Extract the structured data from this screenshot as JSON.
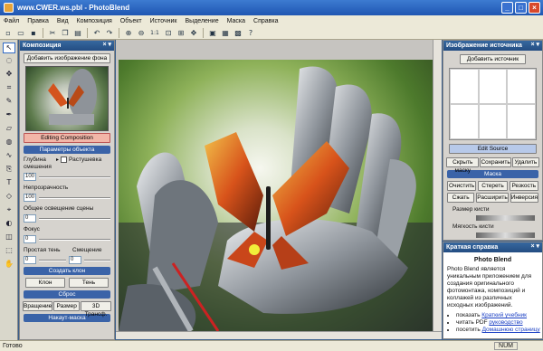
{
  "window": {
    "title": "www.CWER.ws.pbl - PhotoBlend"
  },
  "menu": [
    "Файл",
    "Правка",
    "Вид",
    "Композиция",
    "Объект",
    "Источник",
    "Выделение",
    "Маска",
    "Справка"
  ],
  "toolbar": {
    "zoom_label": "1:1"
  },
  "composition_panel": {
    "title": "Композиция",
    "add_bg_button": "Добавить изображение фона",
    "editing_button": "Editing Composition",
    "object_params_header": "Параметры объекта",
    "blend_depth_label": "Глубина смешения",
    "feather_label": "Растушевка",
    "blend_depth_value": "100",
    "opacity_label": "Непрозрачность",
    "opacity_value": "100",
    "lighting_label": "Общее освещение сцены",
    "lighting_value": "0",
    "focus_label": "Фокус",
    "focus_value": "0",
    "shadow_label": "Простая тень",
    "offset_label": "Смещение",
    "shadow_value": "0",
    "offset_value": "0",
    "create_clone_header": "Создать клон",
    "clone_button": "Клон",
    "shadow_button": "Тень",
    "reset_header": "Сброс",
    "rotation_button": "Вращение",
    "size_button": "Размер",
    "transform_button": "3D Трансф.",
    "overlay_mask_header": "Накаут-маска"
  },
  "source_panel": {
    "title": "Изображение источника",
    "add_source_button": "Добавить источник",
    "edit_source_button": "Edit Source",
    "hide_mask_button": "Скрыть маску",
    "save_button": "Сохранить",
    "delete_button": "Удалить",
    "mask_header": "Маска",
    "clear_button": "Очистить",
    "erase_button": "Стереть",
    "sharpness_button": "Резкость",
    "compress_button": "Сжать",
    "expand_button": "Расширить",
    "invert_button": "Инверсия",
    "brush_size_label": "Размер кисти",
    "brush_softness_label": "Мягкость кисти"
  },
  "help_panel": {
    "title": "Краткая справка",
    "heading": "Photo Blend",
    "body": "Photo Blend является уникальным приложением для создания оригинального фотомонтажа, композиций и коллажей из различных исходных изображений.",
    "bullet1_prefix": "показать ",
    "bullet1_link": "Краткий учебник",
    "bullet2_prefix": "читать PDF ",
    "bullet2_link": "руководство",
    "bullet3_prefix": "посетить ",
    "bullet3_link": "Домашнюю страницу"
  },
  "status": {
    "text": "Готово",
    "num": "NUM"
  }
}
